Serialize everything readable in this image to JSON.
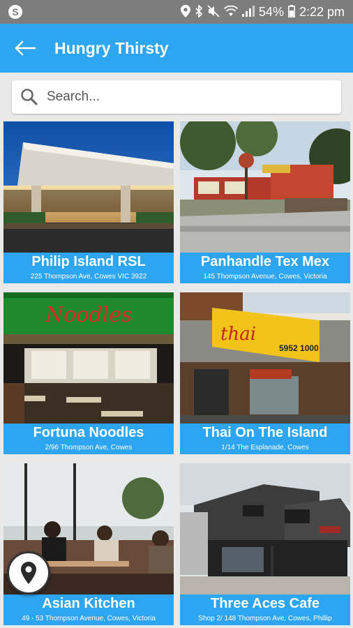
{
  "status_bar": {
    "battery_percent": "54%",
    "time": "2:22 pm",
    "icons": [
      "sync-icon",
      "location-icon",
      "bluetooth-icon",
      "mute-icon",
      "wifi-icon",
      "signal-icon",
      "battery-icon"
    ]
  },
  "app_bar": {
    "title": "Hungry Thirsty",
    "back_icon": "arrow-left-icon"
  },
  "search": {
    "placeholder": "Search...",
    "value": ""
  },
  "venues": [
    {
      "name": "Philip Island RSL",
      "address": "225 Thompson Ave, Cowes VIC 3922"
    },
    {
      "name": "Panhandle Tex Mex",
      "address": "145 Thompson Avenue, Cowes, Victoria"
    },
    {
      "name": "Fortuna Noodles",
      "address": "2/96 Thompson Ave, Cowes"
    },
    {
      "name": "Thai On The Island",
      "address": "1/14 The Esplanade, Cowes"
    },
    {
      "name": "Asian Kitchen",
      "address": "49 - 53 Thompson Avenue, Cowes, Victoria"
    },
    {
      "name": "Three Aces Cafe",
      "address": "Shop 2/ 148 Thompson Ave, Cowes, Phillip"
    }
  ],
  "photo_signage": {
    "fortuna_sign": "Noodles",
    "thai_sign": "thai",
    "thai_phone": "5952 1000"
  },
  "colors": {
    "accent": "#2ea5f0",
    "status_bar": "#7d7d7d",
    "background": "#e9e9e9"
  },
  "map_button": {
    "icon": "map-pin-icon"
  }
}
